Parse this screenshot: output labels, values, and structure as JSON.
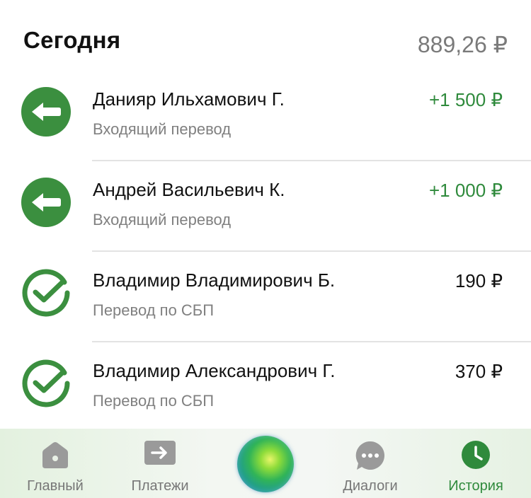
{
  "header": {
    "title": "Сегодня",
    "total": "889,26 ₽"
  },
  "transactions": [
    {
      "name": "Данияр Ильхамович Г.",
      "type": "Входящий перевод",
      "amount": "+1 500 ₽",
      "icon": "incoming-arrow-icon"
    },
    {
      "name": "Андрей Васильевич К.",
      "type": "Входящий перевод",
      "amount": "+1 000 ₽",
      "icon": "incoming-arrow-icon"
    },
    {
      "name": "Владимир Владимирович Б.",
      "type": "Перевод по СБП",
      "amount": "190 ₽",
      "icon": "sber-check-icon"
    },
    {
      "name": "Владимир Александрович Г.",
      "type": "Перевод по СБП",
      "amount": "370 ₽",
      "icon": "sber-check-icon"
    }
  ],
  "tabbar": {
    "home": "Главный",
    "payments": "Платежи",
    "dialogs": "Диалоги",
    "history": "История",
    "active": "history"
  },
  "colors": {
    "accent": "#2f8a3c",
    "icon_green": "#3b8f3f",
    "muted": "#808080",
    "tab_icon": "#9a9a9a"
  }
}
